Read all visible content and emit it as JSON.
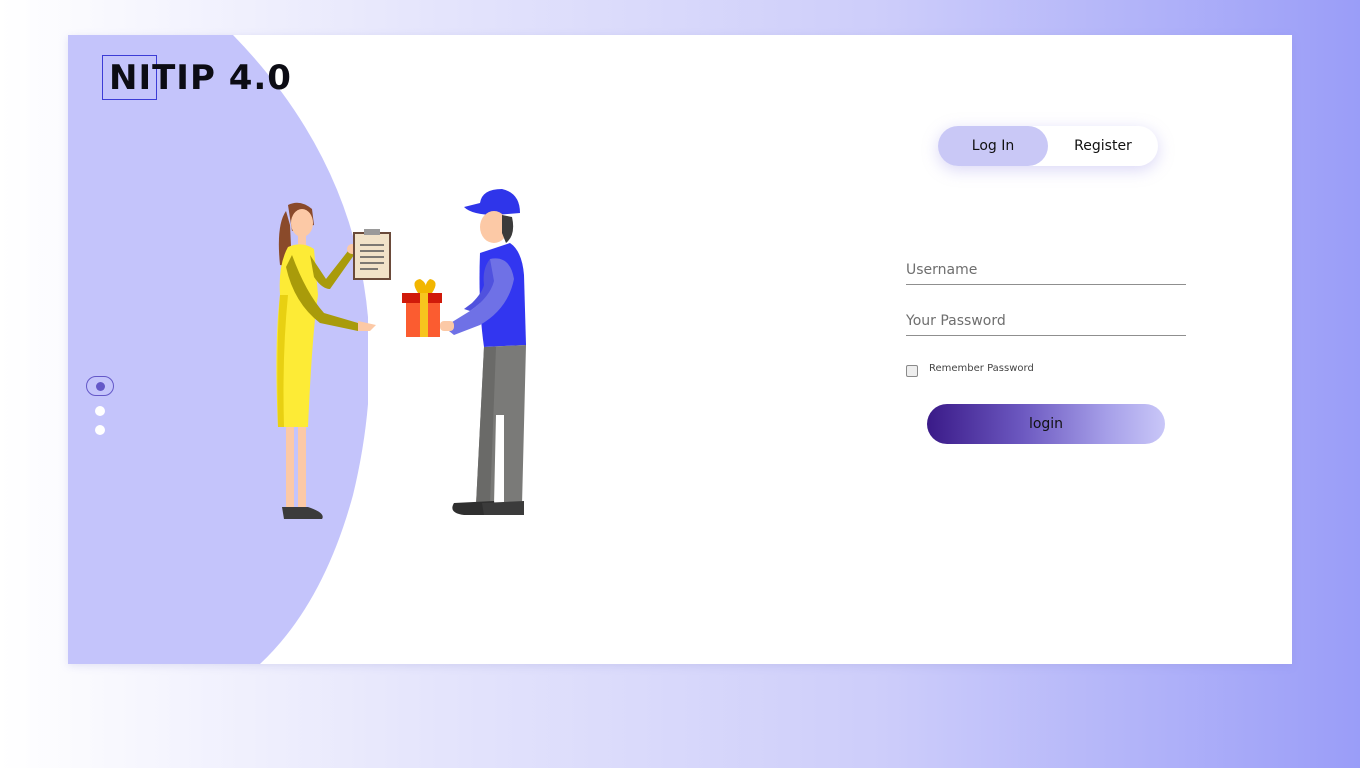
{
  "brand": {
    "name": "NITIP 4.0"
  },
  "colors": {
    "background_start": "#ffffff",
    "background_end": "#9a9df8",
    "side_panel": "#c4c4fb",
    "logo_box": "#3c3cd6",
    "active_tab": "#c9c8f6",
    "button_start": "#3a1a88",
    "button_end": "#c9c7f8"
  },
  "slider": {
    "dot_count": 3,
    "active_index": 0
  },
  "illustration": {
    "icon": "courier-delivering-gift-illustration"
  },
  "tabs": {
    "login_label": "Log In",
    "register_label": "Register",
    "active": "Log In"
  },
  "form": {
    "username_placeholder": "Username",
    "username_value": "",
    "password_placeholder": "Your Password",
    "password_value": "",
    "remember_label": "Remember Password",
    "remember_checked": false,
    "submit_label": "login"
  }
}
